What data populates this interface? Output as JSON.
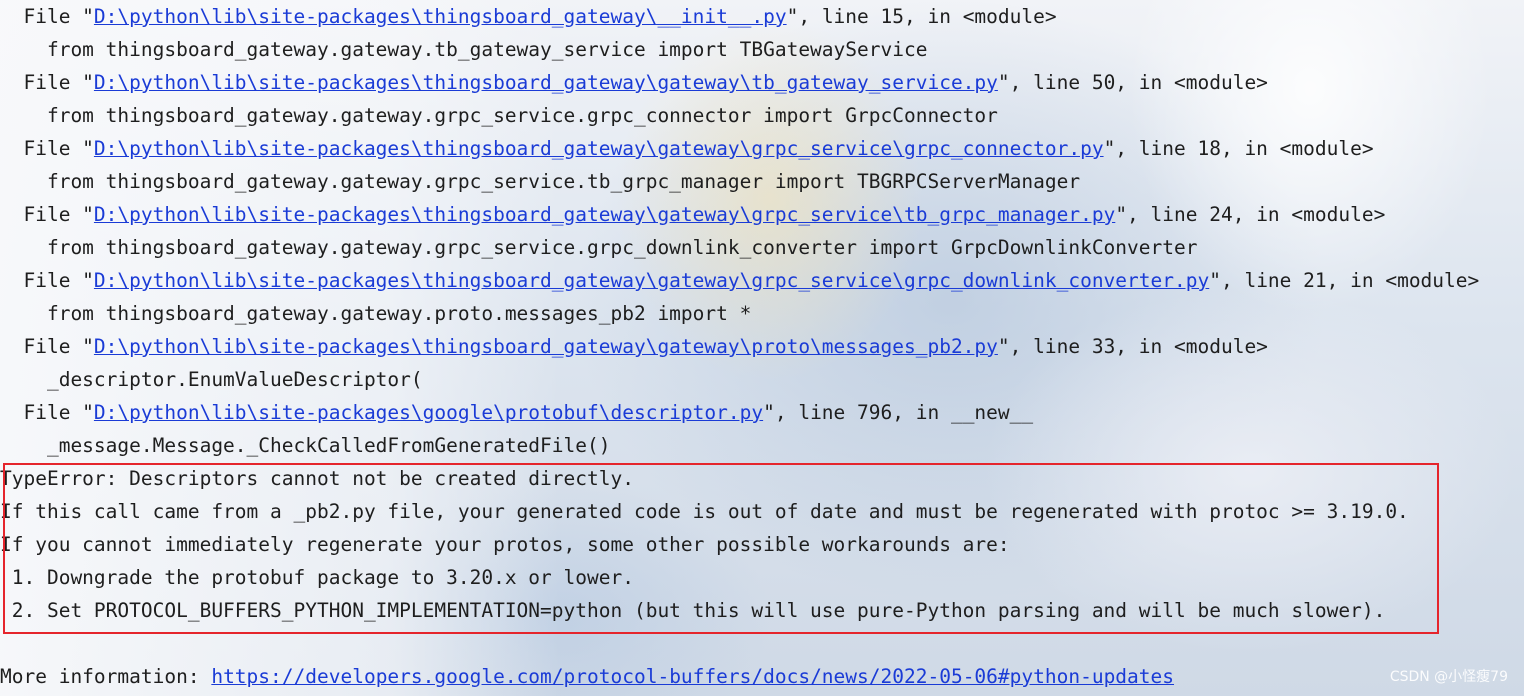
{
  "trace": [
    {
      "pre": "  File \"",
      "link": "D:\\python\\lib\\site-packages\\thingsboard_gateway\\__init__.py",
      "post": "\", line 15, in <module>"
    },
    {
      "text": "    from thingsboard_gateway.gateway.tb_gateway_service import TBGatewayService"
    },
    {
      "pre": "  File \"",
      "link": "D:\\python\\lib\\site-packages\\thingsboard_gateway\\gateway\\tb_gateway_service.py",
      "post": "\", line 50, in <module>"
    },
    {
      "text": "    from thingsboard_gateway.gateway.grpc_service.grpc_connector import GrpcConnector"
    },
    {
      "pre": "  File \"",
      "link": "D:\\python\\lib\\site-packages\\thingsboard_gateway\\gateway\\grpc_service\\grpc_connector.py",
      "post": "\", line 18, in <module>"
    },
    {
      "text": "    from thingsboard_gateway.gateway.grpc_service.tb_grpc_manager import TBGRPCServerManager"
    },
    {
      "pre": "  File \"",
      "link": "D:\\python\\lib\\site-packages\\thingsboard_gateway\\gateway\\grpc_service\\tb_grpc_manager.py",
      "post": "\", line 24, in <module>"
    },
    {
      "text": "    from thingsboard_gateway.gateway.grpc_service.grpc_downlink_converter import GrpcDownlinkConverter"
    },
    {
      "pre": "  File \"",
      "link": "D:\\python\\lib\\site-packages\\thingsboard_gateway\\gateway\\grpc_service\\grpc_downlink_converter.py",
      "post": "\", line 21, in <module>"
    },
    {
      "text": "    from thingsboard_gateway.gateway.proto.messages_pb2 import *"
    },
    {
      "pre": "  File \"",
      "link": "D:\\python\\lib\\site-packages\\thingsboard_gateway\\gateway\\proto\\messages_pb2.py",
      "post": "\", line 33, in <module>"
    },
    {
      "text": "    _descriptor.EnumValueDescriptor("
    },
    {
      "pre": "  File \"",
      "link": "D:\\python\\lib\\site-packages\\google\\protobuf\\descriptor.py",
      "post": "\", line 796, in __new__"
    },
    {
      "text": "    _message.Message._CheckCalledFromGeneratedFile()"
    }
  ],
  "error": [
    "TypeError: Descriptors cannot not be created directly.",
    "If this call came from a _pb2.py file, your generated code is out of date and must be regenerated with protoc >= 3.19.0.",
    "If you cannot immediately regenerate your protos, some other possible workarounds are:",
    " 1. Downgrade the protobuf package to 3.20.x or lower.",
    " 2. Set PROTOCOL_BUFFERS_PYTHON_IMPLEMENTATION=python (but this will use pure-Python parsing and will be much slower)."
  ],
  "more_info": {
    "label": "More information: ",
    "link": "https://developers.google.com/protocol-buffers/docs/news/2022-05-06#python-updates"
  },
  "watermark": "CSDN @小怪瘦79",
  "colors": {
    "link": "#1a3bd6",
    "highlight_border": "#e5252c",
    "text": "#1e1e1e"
  }
}
